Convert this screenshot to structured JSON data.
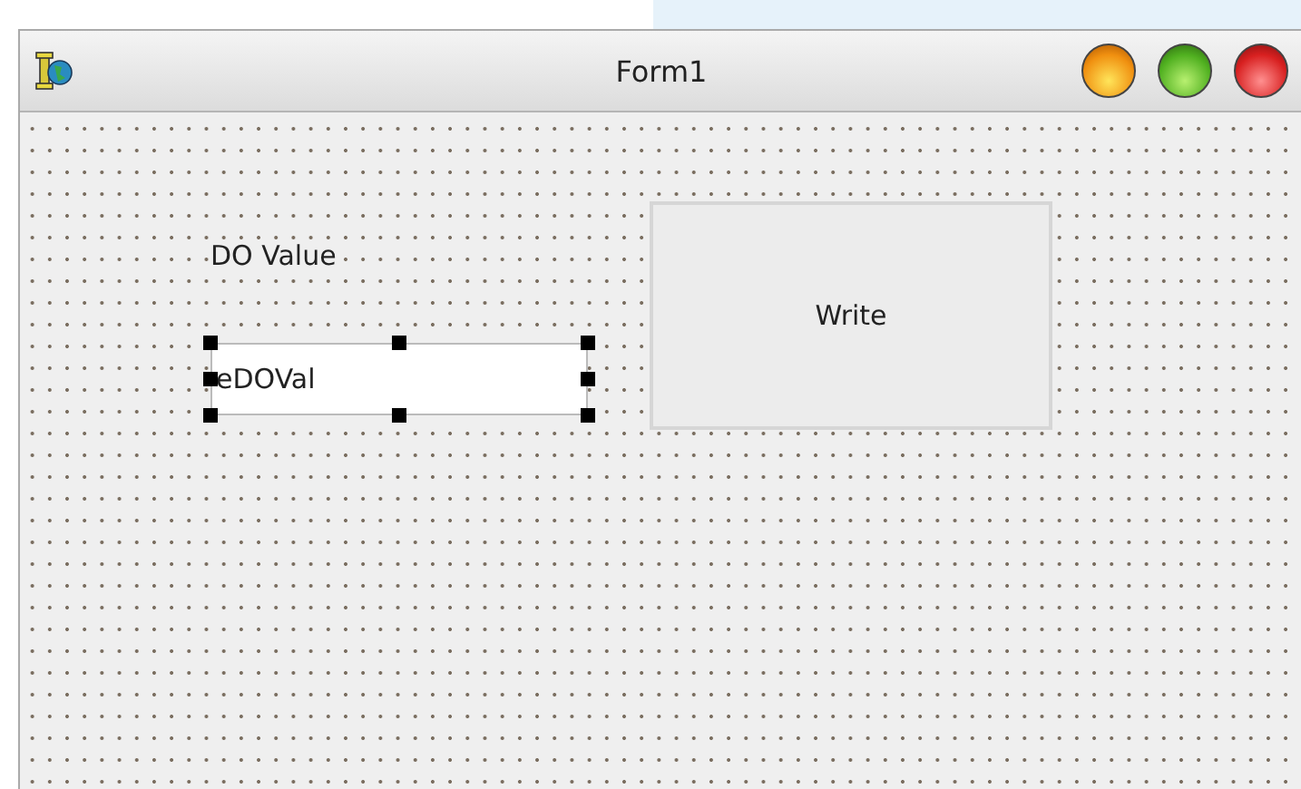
{
  "window": {
    "title": "Form1"
  },
  "controls": [
    {
      "kind": "label",
      "text": "DO Value",
      "selected": false
    },
    {
      "kind": "edit",
      "text": "eDOVal",
      "selected": true
    },
    {
      "kind": "button",
      "text": "Write",
      "selected": false
    }
  ]
}
